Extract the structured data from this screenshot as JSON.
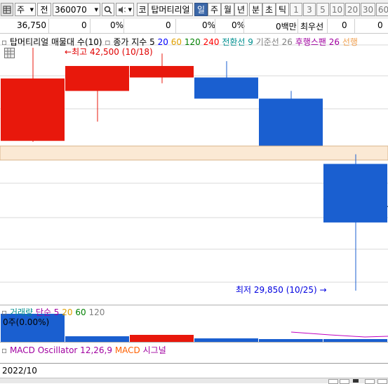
{
  "toolbar": {
    "market": "주",
    "period": "전",
    "code": "360070",
    "search_icon": "magnifier",
    "sound_icon": "speaker",
    "badge": "코",
    "stock_name": "탑머티리얼",
    "periods": [
      "일",
      "주",
      "월",
      "년",
      "분",
      "초",
      "틱"
    ],
    "active_period": "일",
    "numbers": [
      "1",
      "3",
      "5",
      "10",
      "20",
      "30",
      "60"
    ]
  },
  "inforow": {
    "price": "36,750",
    "change": "0",
    "change_pct": "0%",
    "volume": "0",
    "volume_pct": "0%",
    "val_pct": "0%",
    "amount": "0백만",
    "priority_label": "최우선",
    "bid": "0",
    "ask": "0"
  },
  "price_panel": {
    "legend": [
      "탑머티리얼 매물대 수(10)",
      "종가 지수 5",
      "20",
      "60",
      "120",
      "240",
      "전환선 9",
      "기준선 26",
      "후행스팬 26",
      "선행"
    ],
    "legend_colors": [
      "#000000",
      "#000000",
      "#0000ff",
      "#e0a000",
      "#008000",
      "#ff0000",
      "#009090",
      "#808080",
      "#a000a0",
      "#f0a050"
    ],
    "high_label": "최고 42,500 (10/18)",
    "low_label": "최저 29,850 (10/25)",
    "grid_icon": "grid"
  },
  "volume_panel": {
    "legend": [
      "거래량",
      "단순 5",
      "20",
      "60",
      "120"
    ],
    "legend_colors": [
      "#009090",
      "#a000a0",
      "#e0a000",
      "#008000",
      "#808080"
    ],
    "scale": "0주(0.00%)"
  },
  "macd_panel": {
    "legend": [
      "MACD Oscillator 12,26,9",
      "MACD",
      "시그널"
    ],
    "legend_colors": [
      "#a000a0",
      "#ff6000",
      "#a000a0"
    ]
  },
  "date_bar": {
    "label": "2022/10"
  },
  "chart_data": {
    "type": "candlestick",
    "candles": [
      {
        "open": 40900,
        "close": 37650,
        "high": 42500,
        "low": 37600,
        "color": "#e8180c"
      },
      {
        "open": 41550,
        "close": 40250,
        "high": 40250,
        "low": 38650,
        "color": "#e8180c"
      },
      {
        "open": 41550,
        "close": 40950,
        "high": 42200,
        "low": 40650,
        "color": "#e8180c"
      },
      {
        "open": 40950,
        "close": 39850,
        "high": 41800,
        "low": 39850,
        "color": "#1a5fd0"
      },
      {
        "open": 39850,
        "close": 37400,
        "high": 40250,
        "low": 37400,
        "color": "#1a5fd0"
      },
      {
        "open": 36450,
        "close": 33400,
        "high": 36950,
        "low": 29850,
        "color": "#1a5fd0"
      }
    ],
    "volume_colors": [
      "#1a5fd0",
      "#1a5fd0",
      "#e8180c",
      "#1a5fd0",
      "#1a5fd0",
      "#1a5fd0"
    ]
  }
}
